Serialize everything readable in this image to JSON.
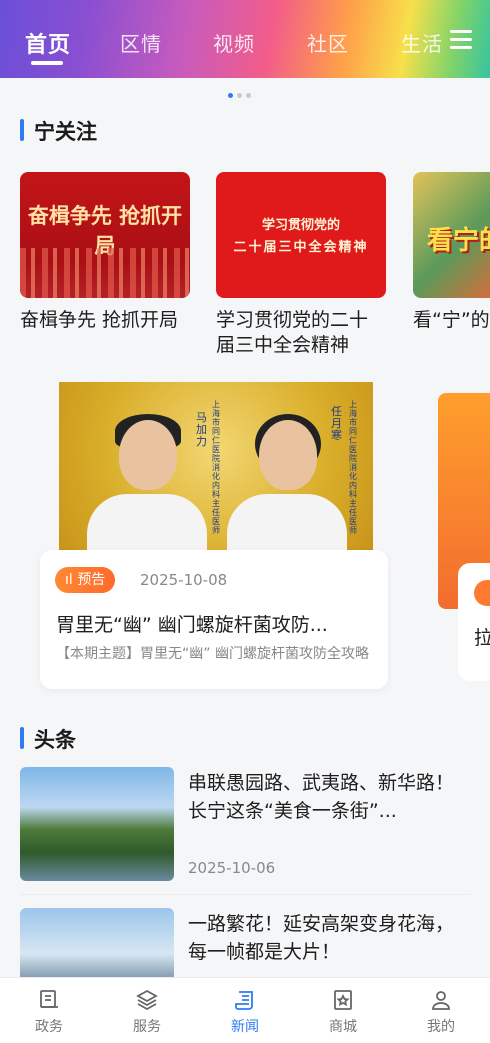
{
  "top_tabs": [
    {
      "label": "首页",
      "active": true
    },
    {
      "label": "区情",
      "active": false
    },
    {
      "label": "视频",
      "active": false
    },
    {
      "label": "社区",
      "active": false
    },
    {
      "label": "生活",
      "active": false
    }
  ],
  "pager_dots": {
    "count": 3,
    "active_index": 0
  },
  "focus_section": {
    "title": "宁关注",
    "cards": [
      {
        "image_text": "奋楫争先 抢抓开局",
        "caption": "奋楫争先 抢抓开局"
      },
      {
        "image_text_line1": "学习贯彻党的",
        "image_text_line2": "二十届三中全会精神",
        "caption": "学习贯彻党的二十届三中全会精神"
      },
      {
        "image_text": "看宁的",
        "caption": "看“宁”的"
      }
    ]
  },
  "video_feature": {
    "doctor1_label": "马加力",
    "doctor1_title": "上海市同仁医院消化内科主任医师",
    "doctor2_label": "任月寒",
    "doctor2_title": "上海市同仁医院消化内科主任医师",
    "tag": "预告",
    "date": "2025-10-08",
    "title": "胃里无“幽” 幽门螺旋杆菌攻防...",
    "description": "【本期主题】胃里无“幽” 幽门螺旋杆菌攻防全攻略",
    "peek_text": "拉"
  },
  "headlines_section": {
    "title": "头条",
    "items": [
      {
        "title": "串联愚园路、武夷路、新华路！长宁这条“美食一条街”...",
        "date": "2025-10-06"
      },
      {
        "title": "一路繁花！延安高架变身花海，每一帧都是大片！",
        "date": ""
      }
    ]
  },
  "bottom_nav": [
    {
      "label": "政务",
      "icon": "government-icon",
      "active": false
    },
    {
      "label": "服务",
      "icon": "layers-icon",
      "active": false
    },
    {
      "label": "新闻",
      "icon": "news-scroll-icon",
      "active": true
    },
    {
      "label": "商城",
      "icon": "mall-star-icon",
      "active": false
    },
    {
      "label": "我的",
      "icon": "user-icon",
      "active": false
    }
  ],
  "colors": {
    "accent": "#2f7bf6",
    "tag_orange": "#ff7a2f"
  }
}
